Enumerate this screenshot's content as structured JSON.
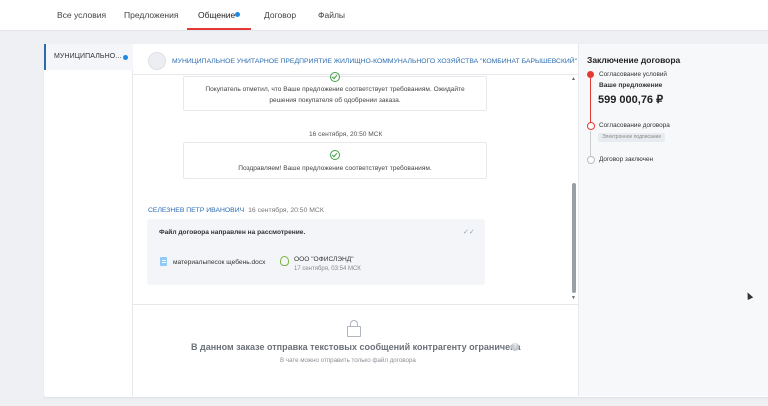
{
  "tabs": [
    {
      "label": "Все условия",
      "active": false
    },
    {
      "label": "Предложения",
      "active": false
    },
    {
      "label": "Общение",
      "active": true,
      "has_notification": true
    },
    {
      "label": "Договор",
      "active": false
    },
    {
      "label": "Файлы",
      "active": false
    }
  ],
  "chat_list": {
    "items": [
      {
        "label": "МУНИЦИПАЛЬНО...",
        "unread": true
      }
    ]
  },
  "chat": {
    "org_name": "МУНИЦИПАЛЬНОЕ УНИТАРНОЕ ПРЕДПРИЯТИЕ ЖИЛИЩНО-КОММУНАЛЬНОГО ХОЗЯЙСТВА \"КОМБИНАТ БАРЫШЕВСКИЙ\"",
    "system_msg_1_line1": "Покупатель отметил, что Ваше предложение соответствует требованиям. Ожидайте",
    "system_msg_1_line2": "решения покупателя об одобрении заказа.",
    "date_separator": "16 сентября, 20:50 МСК",
    "system_msg_2": "Поздравляем! Ваше предложение соответствует требованиям.",
    "sender_name": "СЕЛЕЗНЕВ ПЕТР ИВАНОВИЧ",
    "sender_time": "16 сентября, 20:50 МСК",
    "message_title": "Файл договора направлен на рассмотрение.",
    "file_name": "материалыпесок щебень.docx",
    "signer_name": "ООО \"ОФИСЛЭНД\"",
    "signer_date": "17 сентября, 03:54 МСК",
    "restricted_title": "В данном заказе отправка текстовых сообщений контрагенту ограничена",
    "restricted_hint": "В чате можно отправить только файл договора"
  },
  "contract": {
    "title": "Заключение договора",
    "steps": [
      {
        "label": "Согласование условий",
        "status": "done"
      },
      {
        "label": "Согласование договора",
        "status": "current"
      },
      {
        "label": "Договор заключен",
        "status": "pending"
      }
    ],
    "offer_label": "Ваше предложение",
    "offer_price": "599 000,76 ₽",
    "e_sign_badge": "Электронное подписание"
  },
  "colors": {
    "accent_red": "#e53935",
    "link_blue": "#2b6cb0",
    "success_green": "#43a047"
  }
}
